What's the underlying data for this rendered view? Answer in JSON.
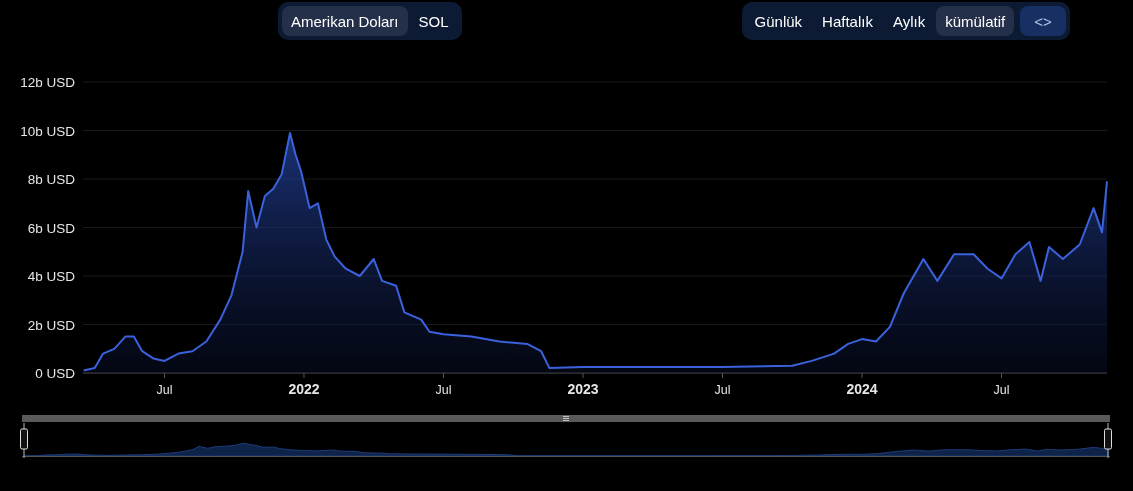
{
  "currency_toggle": [
    {
      "label": "Amerikan Doları",
      "selected": true
    },
    {
      "label": "SOL",
      "selected": false
    }
  ],
  "period_toggle": [
    {
      "label": "Günlük",
      "selected": false
    },
    {
      "label": "Haftalık",
      "selected": false
    },
    {
      "label": "Aylık",
      "selected": false
    },
    {
      "label": "kümülatif",
      "selected": true
    }
  ],
  "embed_button": "<>",
  "chart": {
    "chart_data": {
      "type": "area",
      "grid": true,
      "xlim": [
        2021.208,
        2024.878
      ],
      "ylim": [
        0,
        12
      ],
      "xticks": [
        {
          "value": 2021.5,
          "label": "Jul"
        },
        {
          "value": 2022,
          "label": "2022"
        },
        {
          "value": 2022.5,
          "label": "Jul"
        },
        {
          "value": 2023,
          "label": "2023"
        },
        {
          "value": 2023.5,
          "label": "Jul"
        },
        {
          "value": 2024,
          "label": "2024"
        },
        {
          "value": 2024.5,
          "label": "Jul"
        }
      ],
      "yticks": [
        {
          "value": 0,
          "label": "0 USD"
        },
        {
          "value": 2,
          "label": "2b USD"
        },
        {
          "value": 4,
          "label": "4b USD"
        },
        {
          "value": 6,
          "label": "6b USD"
        },
        {
          "value": 8,
          "label": "8b USD"
        },
        {
          "value": 10,
          "label": "10b USD"
        },
        {
          "value": 12,
          "label": "12b USD"
        }
      ],
      "x": [
        2021.21,
        2021.25,
        2021.28,
        2021.32,
        2021.36,
        2021.39,
        2021.42,
        2021.46,
        2021.5,
        2021.55,
        2021.6,
        2021.65,
        2021.7,
        2021.74,
        2021.78,
        2021.8,
        2021.83,
        2021.86,
        2021.89,
        2021.92,
        2021.95,
        2021.97,
        2021.99,
        2022.02,
        2022.05,
        2022.08,
        2022.11,
        2022.15,
        2022.2,
        2022.25,
        2022.28,
        2022.33,
        2022.36,
        2022.42,
        2022.45,
        2022.5,
        2022.6,
        2022.7,
        2022.8,
        2022.85,
        2022.88,
        2023.0,
        2023.25,
        2023.5,
        2023.75,
        2023.82,
        2023.9,
        2023.95,
        2024.0,
        2024.05,
        2024.1,
        2024.15,
        2024.22,
        2024.27,
        2024.33,
        2024.4,
        2024.45,
        2024.5,
        2024.55,
        2024.6,
        2024.64,
        2024.67,
        2024.72,
        2024.78,
        2024.83,
        2024.86,
        2024.878
      ],
      "series": [
        {
          "color": "#3b62dd",
          "values": [
            0.1,
            0.2,
            0.8,
            1.0,
            1.5,
            1.5,
            0.9,
            0.6,
            0.5,
            0.8,
            0.9,
            1.3,
            2.2,
            3.2,
            5.0,
            7.5,
            6.0,
            7.3,
            7.6,
            8.2,
            9.9,
            9.0,
            8.3,
            6.8,
            7.0,
            5.5,
            4.8,
            4.3,
            4.0,
            4.7,
            3.8,
            3.6,
            2.5,
            2.2,
            1.7,
            1.6,
            1.5,
            1.3,
            1.2,
            0.9,
            0.2,
            0.25,
            0.25,
            0.25,
            0.3,
            0.5,
            0.8,
            1.2,
            1.4,
            1.3,
            1.9,
            3.3,
            4.7,
            3.8,
            4.9,
            4.9,
            4.3,
            3.9,
            4.9,
            5.4,
            3.8,
            5.2,
            4.7,
            5.3,
            6.8,
            5.8,
            7.9
          ]
        }
      ]
    }
  }
}
